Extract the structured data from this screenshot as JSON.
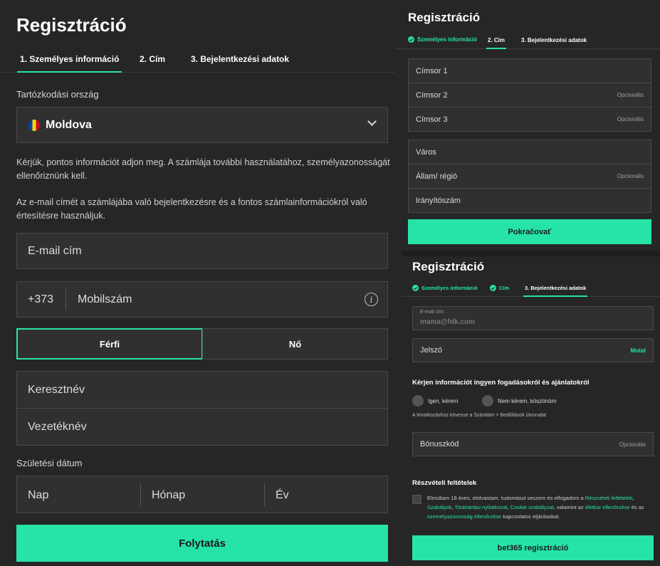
{
  "left": {
    "title": "Regisztráció",
    "tabs": [
      "1. Személyes információ",
      "2. Cím",
      "3. Bejelentkezési adatok"
    ],
    "country_label": "Tartózkodási ország",
    "country_value": "Moldova",
    "info_text_1": "Kérjük, pontos információt adjon meg. A számlája további használatához, személyazonosságát ellenőriznünk kell.",
    "info_text_2": "Az e-mail címét a számlájába való bejelentkezésre és a fontos számlainformációkról való értesítésre használjuk.",
    "email_placeholder": "E-mail cím",
    "phone_prefix": "+373",
    "phone_placeholder": "Mobilszám",
    "gender_male": "Férfi",
    "gender_female": "Nő",
    "first_name": "Keresztnév",
    "last_name": "Vezetéknév",
    "dob_label": "Születési dátum",
    "dob_day": "Nap",
    "dob_month": "Hónap",
    "dob_year": "Év",
    "continue": "Folytatás"
  },
  "topright": {
    "title": "Regisztráció",
    "tabs": [
      "Személyes információ",
      "2. Cím",
      "3. Bejelentkezési adatok"
    ],
    "address1": "Címsor 1",
    "address2": "Címsor 2",
    "address3": "Címsor 3",
    "city": "Város",
    "state": "Állam/ régió",
    "zip": "Irányítószám",
    "optional": "Opcionális",
    "continue": "Pokračovať"
  },
  "bottomright": {
    "title": "Regisztráció",
    "tabs": [
      "Személyes információ",
      "Cím",
      "3. Bejelentkezési adatok"
    ],
    "email_label": "E-mail cím",
    "email_value": "mama@fdk.com",
    "password": "Jelszó",
    "show": "Mutat",
    "offers_heading": "Kérjen információt ingyen fogadásokról és ajánlatokról",
    "yes": "Igen, kérem",
    "no": "Nem kérem, köszönöm",
    "unsubscribe": "A leiratkozáshoz kövesse a Számlám > Beállítások útvonalat",
    "bonus": "Bónuszkód",
    "optional": "Opcionális",
    "terms_heading": "Részvételi feltételek",
    "terms": {
      "t1": "Elmúltam 18 éves, elolvastam, tudomásul veszem és elfogadom a ",
      "l1": "Részvételi feltételek",
      "t2": ", ",
      "l2": "Szabályok",
      "t3": ", ",
      "l3": "Titoktartási nyilatkozat",
      "t4": ", ",
      "l4": "Cookie szabályzat",
      "t5": ", valamint az ",
      "l5": "életkor ellenőrzése",
      "t6": " és az ",
      "l6": "személyazonosság ellenőrzése",
      "t7": " kapcsolatos eljárásokat."
    },
    "register": "bet365 regisztráció"
  },
  "colors": {
    "accent": "#26e3a8",
    "panel": "#262626",
    "field": "#303030",
    "border": "#4a4a4a"
  }
}
